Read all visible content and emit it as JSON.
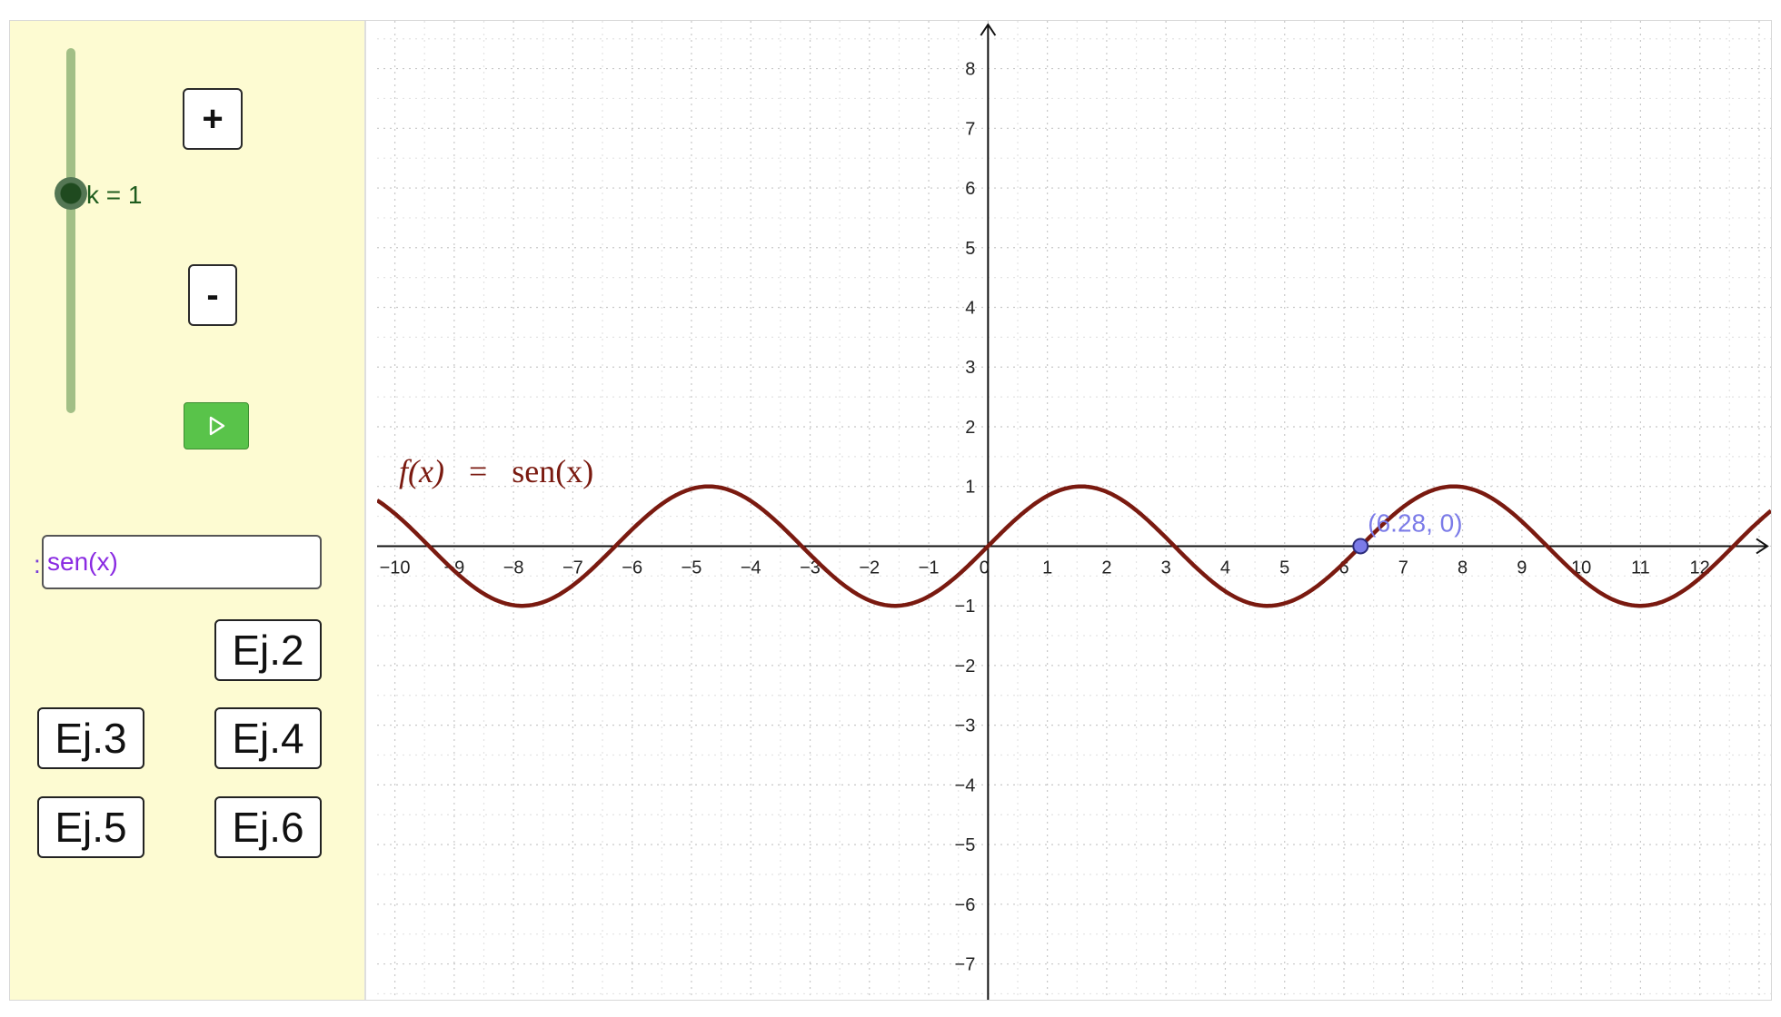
{
  "slider": {
    "label": "k = 1",
    "value": 1
  },
  "buttons": {
    "plus": "+",
    "minus": "-"
  },
  "input": {
    "caption": ":",
    "value": "sen(x)"
  },
  "exercises": {
    "ej2": "Ej.2",
    "ej3": "Ej.3",
    "ej4": "Ej.4",
    "ej5": "Ej.5",
    "ej6": "Ej.6"
  },
  "icons": {
    "play": "play-icon",
    "reset": "refresh-icon",
    "fullscreen": "fullscreen-icon"
  },
  "colors": {
    "panel_bg": "#fdfbd2",
    "slider_track": "#a2bf86",
    "curve": "#7a1a10",
    "point": "#7b7be8",
    "play_button": "#59c34a",
    "grid": "#cfcfcf"
  },
  "chart_data": {
    "type": "line",
    "function_label": {
      "lhs": "f(x)",
      "eq": "=",
      "rhs": "sen(x)"
    },
    "xlim": [
      -10.3,
      13.2
    ],
    "ylim": [
      -7.6,
      8.8
    ],
    "x_ticks": [
      -10,
      -9,
      -8,
      -7,
      -6,
      -5,
      -4,
      -3,
      -2,
      -1,
      0,
      1,
      2,
      3,
      4,
      5,
      6,
      7,
      8,
      9,
      10,
      11,
      12
    ],
    "y_ticks": [
      -7,
      -6,
      -5,
      -4,
      -3,
      -2,
      -1,
      1,
      2,
      3,
      4,
      5,
      6,
      7,
      8
    ],
    "grid": true,
    "minor_grid": true,
    "series": [
      {
        "function": "sin",
        "k": 1,
        "x_range": [
          -10.3,
          13.2
        ]
      }
    ],
    "point": {
      "x": 6.28,
      "y": 0,
      "label": "(6.28, 0)"
    }
  }
}
